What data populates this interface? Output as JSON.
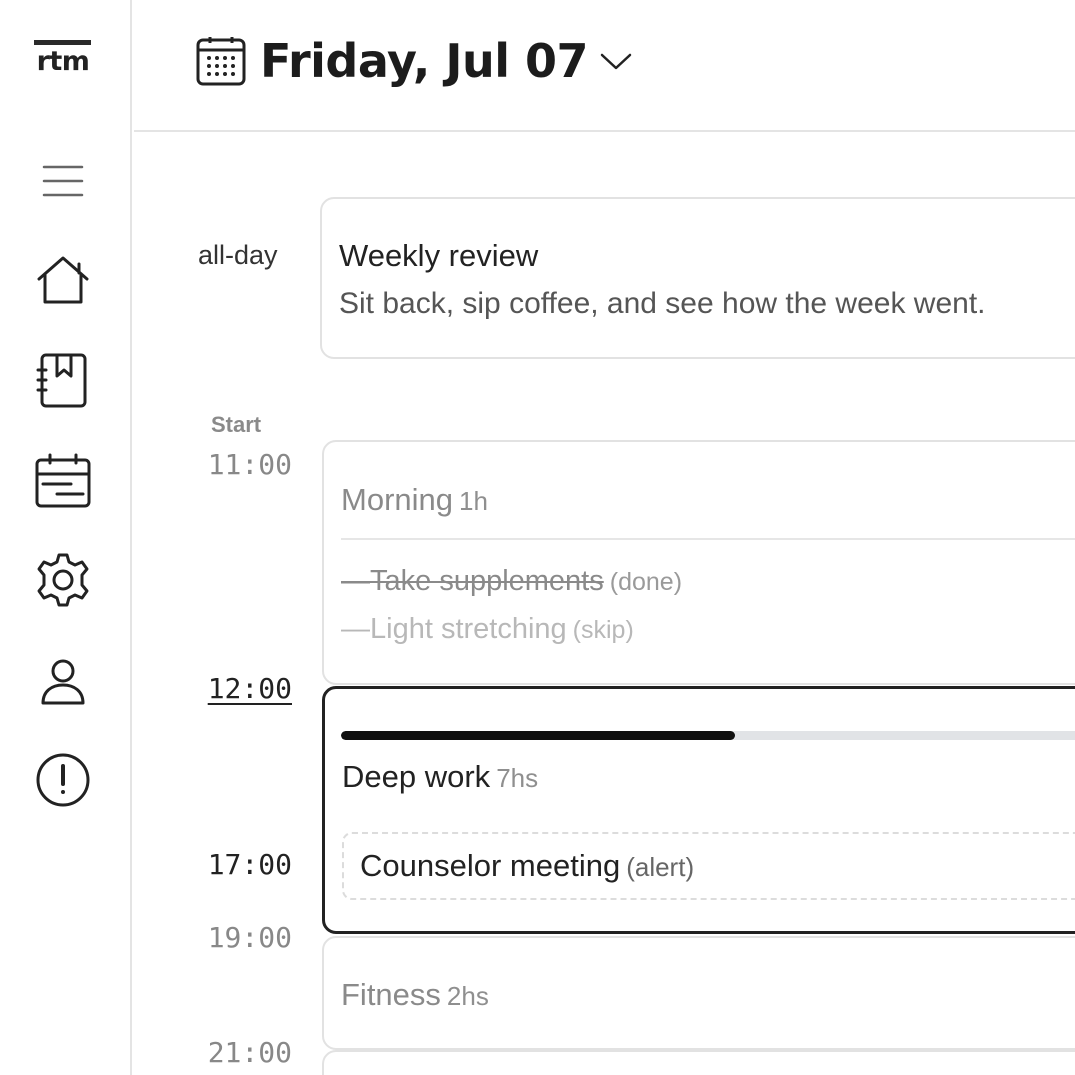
{
  "app": {
    "logo_text": "rtm"
  },
  "sidebar": {
    "items": [
      {
        "name": "menu",
        "icon": "hamburger-icon"
      },
      {
        "name": "home",
        "icon": "home-icon"
      },
      {
        "name": "lists",
        "icon": "notebook-icon"
      },
      {
        "name": "calendar",
        "icon": "calendar-card-icon"
      },
      {
        "name": "settings",
        "icon": "gear-icon"
      },
      {
        "name": "profile",
        "icon": "user-icon"
      },
      {
        "name": "alerts",
        "icon": "alert-circle-icon"
      }
    ]
  },
  "header": {
    "date": "Friday, Jul 07",
    "icon": "calendar-icon",
    "dropdown_icon": "chevron-down-icon"
  },
  "timeline": {
    "allday_label": "all-day",
    "start_label": "Start",
    "times": {
      "t1100": "11:00",
      "t1200": "12:00",
      "t1700": "17:00",
      "t1900": "19:00",
      "t2100": "21:00"
    }
  },
  "events": {
    "allday": {
      "title": "Weekly review",
      "description": "Sit back, sip coffee, and see how the week went."
    },
    "morning": {
      "title": "Morning",
      "duration": "1h",
      "tasks": [
        {
          "text": "—Take supplements",
          "status": "(done)"
        },
        {
          "text": "—Light stretching",
          "status": "(skip)"
        }
      ]
    },
    "deep_work": {
      "title": "Deep work",
      "duration": "7hs",
      "progress_percent": 52,
      "sub_event": {
        "title": "Counselor meeting",
        "tag": "(alert)"
      }
    },
    "fitness": {
      "title": "Fitness",
      "duration": "2hs"
    }
  }
}
